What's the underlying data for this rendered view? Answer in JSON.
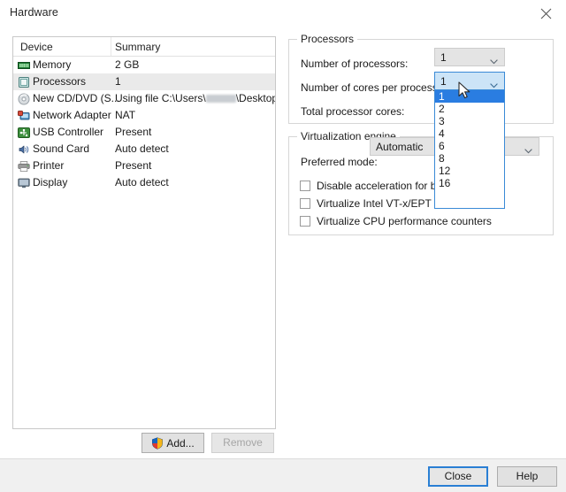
{
  "window": {
    "title": "Hardware",
    "close_icon": "close-icon"
  },
  "device_list": {
    "columns": [
      "Device",
      "Summary"
    ],
    "rows": [
      {
        "icon": "memory-icon",
        "name": "Memory",
        "summary": "2 GB",
        "selected": false
      },
      {
        "icon": "processor-icon",
        "name": "Processors",
        "summary": "1",
        "selected": true
      },
      {
        "icon": "cd-dvd-icon",
        "name": "New CD/DVD (S...",
        "summary": "Using file C:\\Users\\",
        "summary_suffix": "\\Desktop\\W...",
        "redacted": true,
        "selected": false
      },
      {
        "icon": "network-adapter-icon",
        "name": "Network Adapter",
        "summary": "NAT",
        "selected": false
      },
      {
        "icon": "usb-controller-icon",
        "name": "USB Controller",
        "summary": "Present",
        "selected": false
      },
      {
        "icon": "sound-card-icon",
        "name": "Sound Card",
        "summary": "Auto detect",
        "selected": false
      },
      {
        "icon": "printer-icon",
        "name": "Printer",
        "summary": "Present",
        "selected": false
      },
      {
        "icon": "display-icon",
        "name": "Display",
        "summary": "Auto detect",
        "selected": false
      }
    ]
  },
  "list_buttons": {
    "add_label": "Add...",
    "add_icon": "shield-icon",
    "remove_label": "Remove",
    "remove_disabled": true
  },
  "processors_group": {
    "legend": "Processors",
    "num_processors_label": "Number of processors:",
    "num_processors_value": "1",
    "cores_label": "Number of cores per processor:",
    "cores_value": "1",
    "total_cores_label": "Total processor cores:",
    "dropdown_open": true,
    "dropdown_options": [
      "1",
      "2",
      "3",
      "4",
      "6",
      "8",
      "12",
      "16"
    ],
    "dropdown_selected": "1"
  },
  "virtualization_group": {
    "legend": "Virtualization engine",
    "preferred_mode_label": "Preferred mode:",
    "preferred_mode_value": "Automatic",
    "checkboxes": [
      {
        "label": "Disable acceleration for binary",
        "checked": false
      },
      {
        "label": "Virtualize Intel VT-x/EPT or AMD-V/RVI",
        "checked": false
      },
      {
        "label": "Virtualize CPU performance counters",
        "checked": false
      }
    ]
  },
  "footer": {
    "close_label": "Close",
    "help_label": "Help"
  },
  "colors": {
    "accent": "#2a7de1",
    "focus_border": "#3a8ad6",
    "selection_row": "#eaeaea",
    "footer_bg": "#f0f0f0"
  }
}
